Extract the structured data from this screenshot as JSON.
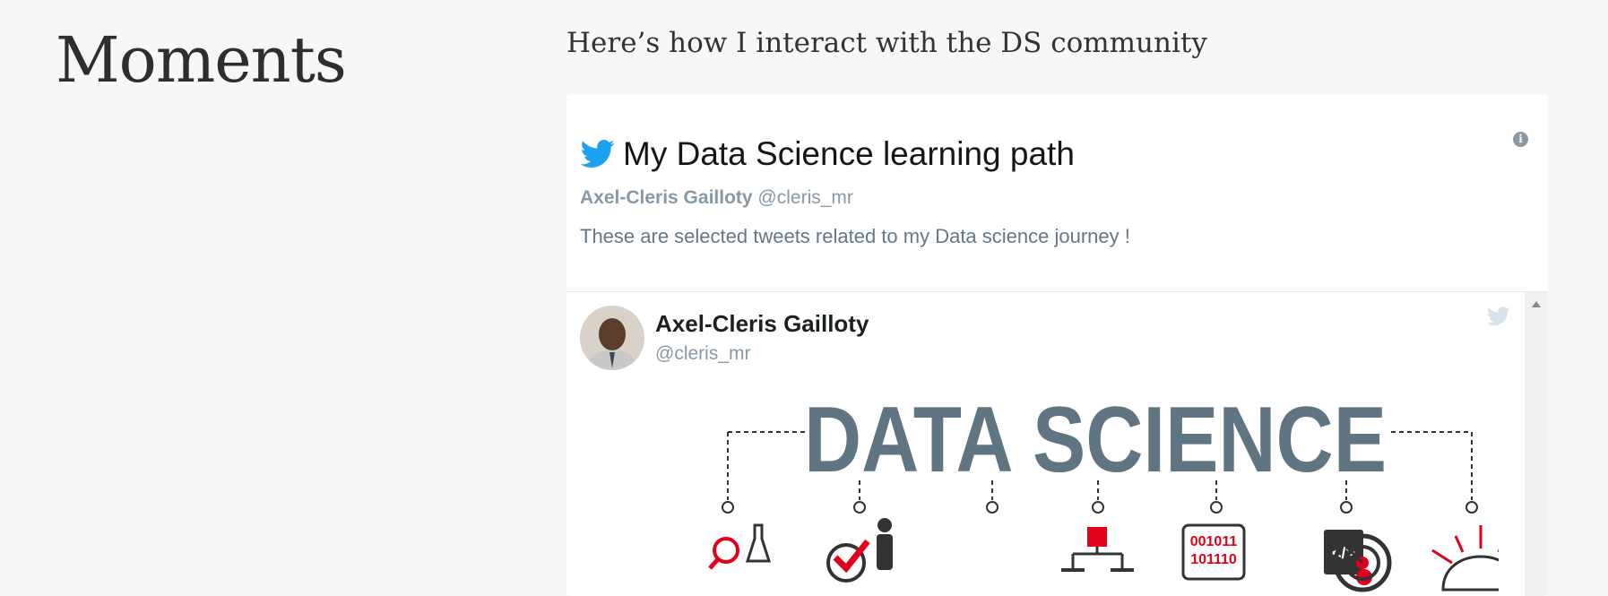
{
  "page": {
    "title": "Moments",
    "subtitle": "Here’s how I interact with the DS community"
  },
  "timeline": {
    "title": "My Data Science learning path",
    "curator_name": "Axel-Cleris Gailloty",
    "curator_handle": "@cleris_mr",
    "description": "These are selected tweets related to my Data science journey !",
    "info_icon": "info-icon"
  },
  "tweet": {
    "author_name": "Axel-Cleris Gailloty",
    "author_handle": "@cleris_mr",
    "image": {
      "headline": "DATA SCIENCE",
      "bits_line1": "001011",
      "bits_line2": "101110",
      "code_glyph": "</>"
    }
  },
  "colors": {
    "twitter_blue": "#1da1f2",
    "muted_gray": "#8899a6",
    "headline_slate": "#5f7682",
    "accent_red": "#e2001a"
  }
}
